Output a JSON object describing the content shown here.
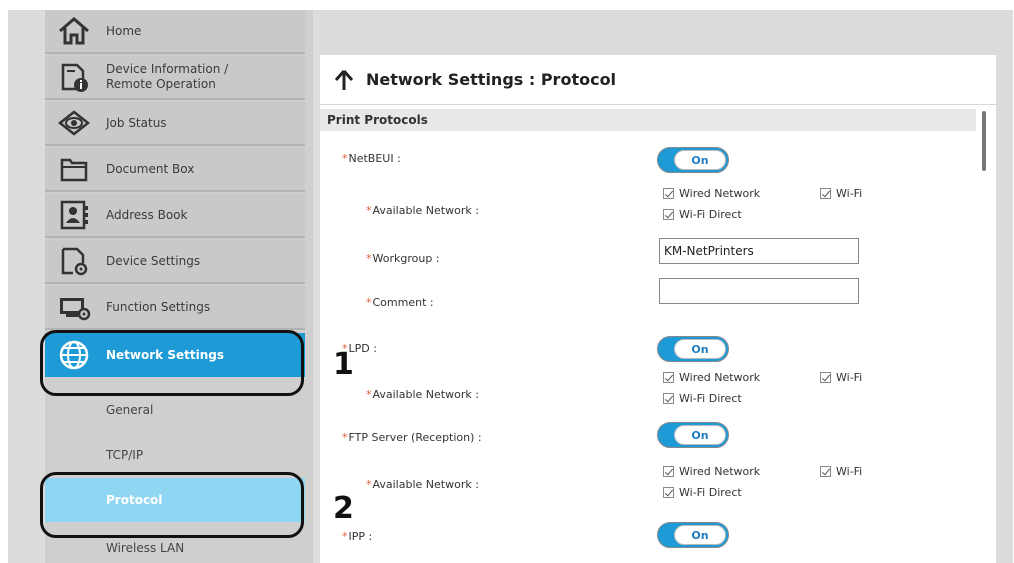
{
  "sidebar": {
    "items": [
      {
        "label": "Home",
        "icon": "home-icon"
      },
      {
        "label": "Device Information /\nRemote Operation",
        "icon": "device-info-icon"
      },
      {
        "label": "Job Status",
        "icon": "eye-icon"
      },
      {
        "label": "Document Box",
        "icon": "folder-icon"
      },
      {
        "label": "Address Book",
        "icon": "address-book-icon"
      },
      {
        "label": "Device Settings",
        "icon": "device-settings-icon"
      },
      {
        "label": "Function Settings",
        "icon": "function-settings-icon"
      },
      {
        "label": "Network Settings",
        "icon": "globe-icon",
        "active": true
      }
    ],
    "sub_items": [
      {
        "label": "General"
      },
      {
        "label": "TCP/IP"
      },
      {
        "label": "Protocol",
        "active": true
      },
      {
        "label": "Wireless LAN"
      }
    ]
  },
  "callouts": {
    "one": "1",
    "two": "2"
  },
  "page": {
    "title": "Network Settings : Protocol",
    "section": "Print Protocols"
  },
  "form": {
    "netbeui": {
      "label": "NetBEUI :",
      "toggle": "On"
    },
    "netbeui_network": {
      "label": "Available Network :",
      "wired": "Wired Network",
      "wifi": "Wi-Fi",
      "direct": "Wi-Fi Direct"
    },
    "workgroup": {
      "label": "Workgroup :",
      "value": "KM-NetPrinters"
    },
    "comment": {
      "label": "Comment :",
      "value": ""
    },
    "lpd": {
      "label": "LPD :",
      "toggle": "On"
    },
    "lpd_network": {
      "label": "Available Network :",
      "wired": "Wired Network",
      "wifi": "Wi-Fi",
      "direct": "Wi-Fi Direct"
    },
    "ftp": {
      "label": "FTP Server (Reception) :",
      "toggle": "On"
    },
    "ftp_network": {
      "label": "Available Network :",
      "wired": "Wired Network",
      "wifi": "Wi-Fi",
      "direct": "Wi-Fi Direct"
    },
    "ipp": {
      "label": "IPP :",
      "toggle": "On"
    }
  },
  "colors": {
    "accent": "#1e9bd7",
    "accent_light": "#8fd6f2",
    "required": "#e05a3a"
  }
}
